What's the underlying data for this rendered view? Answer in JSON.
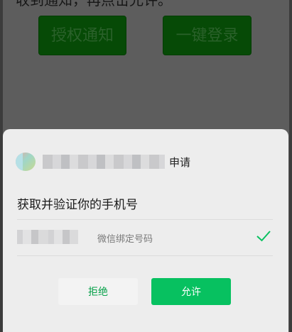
{
  "background": {
    "note_text": "收到通知，再点击允许。",
    "buttons": [
      {
        "label": "授权通知"
      },
      {
        "label": "一键登录"
      }
    ]
  },
  "sheet": {
    "app": {
      "logo_icon": "app-logo",
      "apply_label": "申请"
    },
    "headline": "获取并验证你的手机号",
    "phone": {
      "description": "微信绑定号码",
      "selected_icon": "check-icon",
      "check_color": "#07c160"
    },
    "actions": {
      "reject_label": "拒绝",
      "allow_label": "允许"
    }
  },
  "colors": {
    "primary_green": "#07c160",
    "background_button": "#0a6e0a"
  }
}
